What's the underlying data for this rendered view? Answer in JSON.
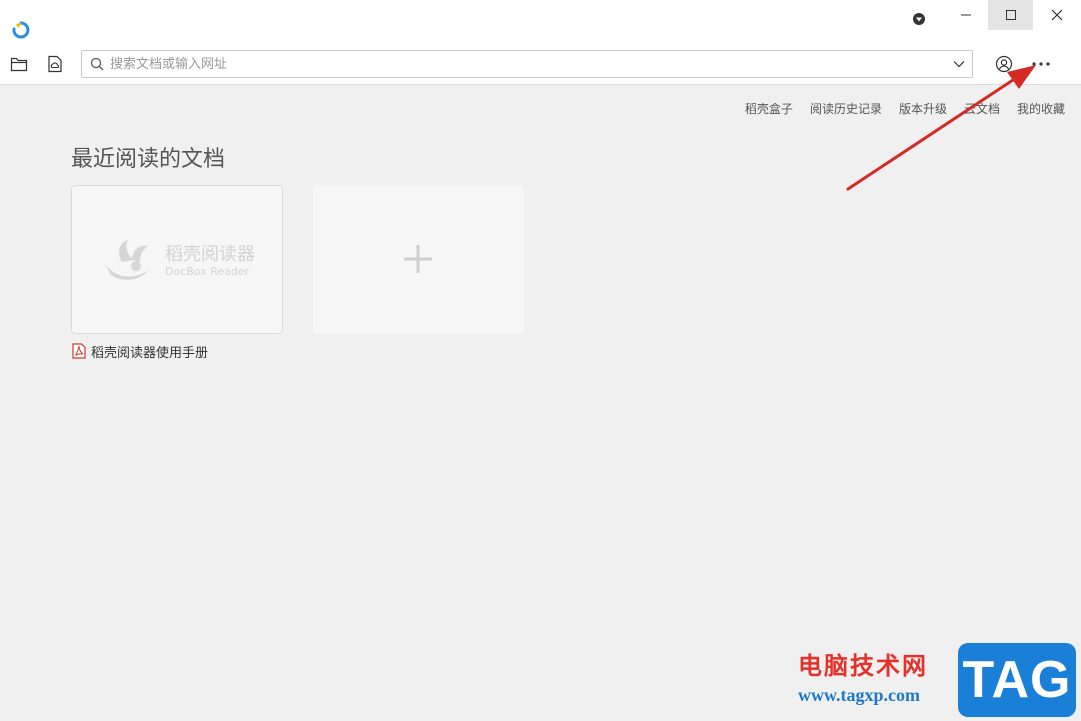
{
  "toolbar": {
    "search_placeholder": "搜索文档或输入网址"
  },
  "top_links": [
    "稻壳盒子",
    "阅读历史记录",
    "版本升级",
    "云文档",
    "我的收藏"
  ],
  "recent": {
    "title": "最近阅读的文档",
    "documents": [
      {
        "thumb_name": "稻壳阅读器",
        "thumb_subtitle": "DocBox Reader",
        "file_name": "稻壳阅读器使用手册"
      }
    ]
  },
  "watermark": {
    "site_name": "电脑技术网",
    "url": "www.tagxp.com",
    "badge": "TAG"
  },
  "colors": {
    "accent": "#1a7fd6",
    "arrow": "#d42a24",
    "pdf": "#d03a2e"
  }
}
